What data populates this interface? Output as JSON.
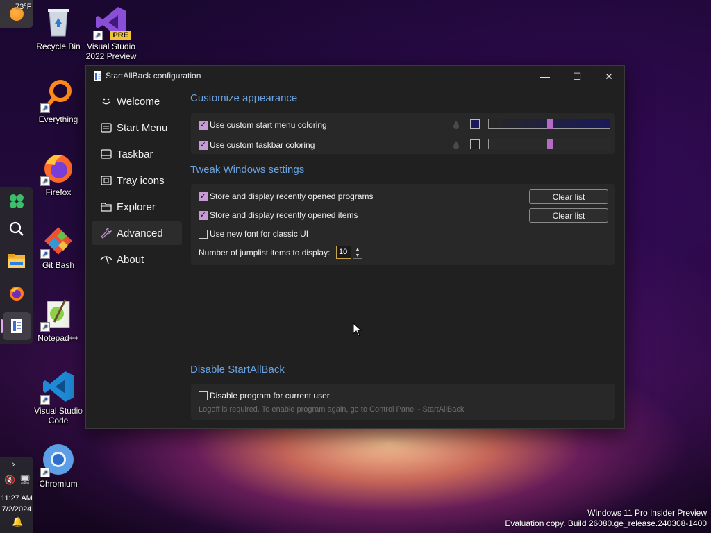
{
  "taskbar": {
    "weather_temp": "73°F",
    "clock_time": "11:27 AM",
    "clock_date": "7/2/2024",
    "pinned": [
      {
        "icon": "widgets-icon"
      },
      {
        "icon": "search-icon"
      },
      {
        "icon": "file-explorer-icon"
      },
      {
        "icon": "firefox-icon"
      },
      {
        "icon": "startallback-icon"
      }
    ]
  },
  "desktop": {
    "icons": [
      {
        "label": "Recycle Bin",
        "icon": "recycle-bin-icon"
      },
      {
        "label": "Visual Studio 2022 Preview",
        "icon": "visual-studio-preview-icon",
        "badge": "PRE"
      },
      {
        "label": "Everything",
        "icon": "everything-icon"
      },
      {
        "label": "Firefox",
        "icon": "firefox-icon"
      },
      {
        "label": "Git Bash",
        "icon": "git-bash-icon"
      },
      {
        "label": "Notepad++",
        "icon": "notepad-plus-plus-icon"
      },
      {
        "label": "Visual Studio Code",
        "icon": "vscode-icon"
      },
      {
        "label": "Chromium",
        "icon": "chromium-icon"
      }
    ]
  },
  "window": {
    "title": "StartAllBack configuration",
    "controls": {
      "minimize": "—",
      "maximize": "☐",
      "close": "✕"
    },
    "nav": [
      {
        "label": "Welcome",
        "icon": "smile-icon",
        "active": false
      },
      {
        "label": "Start Menu",
        "icon": "start-menu-icon",
        "active": false
      },
      {
        "label": "Taskbar",
        "icon": "taskbar-icon",
        "active": false
      },
      {
        "label": "Tray icons",
        "icon": "tray-icon",
        "active": false
      },
      {
        "label": "Explorer",
        "icon": "folder-icon",
        "active": false
      },
      {
        "label": "Advanced",
        "icon": "wrench-icon",
        "active": true
      },
      {
        "label": "About",
        "icon": "about-icon",
        "active": false
      }
    ],
    "appearance": {
      "title": "Customize appearance",
      "start_menu_coloring": {
        "label": "Use custom start menu coloring",
        "checked": true,
        "swatch": "#1a1a5a"
      },
      "taskbar_coloring": {
        "label": "Use custom taskbar coloring",
        "checked": true,
        "swatch": "#202020"
      }
    },
    "tweak": {
      "title": "Tweak Windows settings",
      "recent_programs": {
        "label": "Store and display recently opened programs",
        "checked": true,
        "button": "Clear list"
      },
      "recent_items": {
        "label": "Store and display recently opened items",
        "checked": true,
        "button": "Clear list"
      },
      "new_font": {
        "label": "Use new font for classic UI",
        "checked": false
      },
      "jumplist": {
        "label": "Number of jumplist items to display:",
        "value": "10"
      }
    },
    "disable": {
      "title": "Disable StartAllBack",
      "checkbox": {
        "label": "Disable program for current user",
        "checked": false
      },
      "note": "Logoff is required. To enable program again, go to Control Panel - StartAllBack"
    }
  },
  "watermark": {
    "line1": "Windows 11 Pro Insider Preview",
    "line2": "Evaluation copy. Build 26080.ge_release.240308-1400"
  },
  "colors": {
    "accent": "#6aa2e0",
    "checkbox": "#c89ad8",
    "slider_thumb": "#b46ac7"
  }
}
